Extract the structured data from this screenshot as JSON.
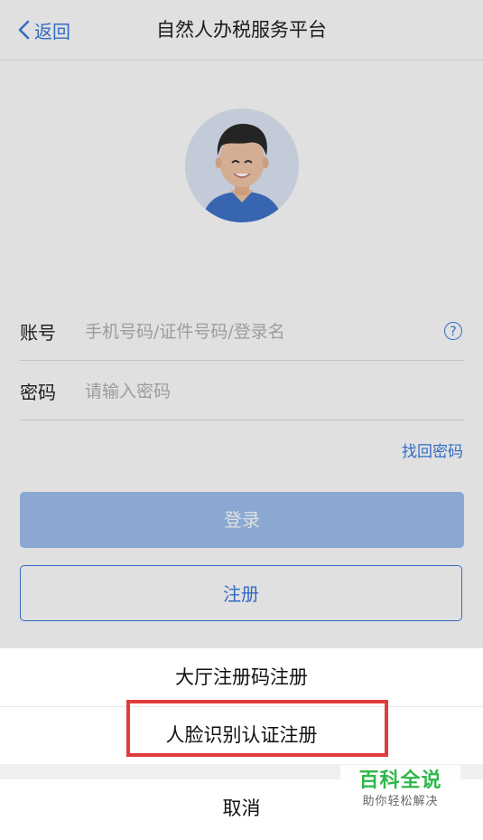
{
  "navbar": {
    "back_label": "返回",
    "title": "自然人办税服务平台"
  },
  "login_form": {
    "account_label": "账号",
    "account_placeholder": "手机号码/证件号码/登录名",
    "password_label": "密码",
    "password_placeholder": "请输入密码",
    "forgot_password": "找回密码",
    "login_button": "登录",
    "register_button": "注册"
  },
  "action_sheet": {
    "items": [
      {
        "label": "大厅注册码注册"
      },
      {
        "label": "人脸识别认证注册",
        "highlighted": true
      }
    ],
    "cancel": "取消"
  },
  "watermark": {
    "title": "百科全说",
    "subtitle": "助你轻松解决"
  },
  "colors": {
    "accent": "#3a7be0",
    "highlight": "#e23b3b",
    "watermark": "#2fb84a"
  }
}
